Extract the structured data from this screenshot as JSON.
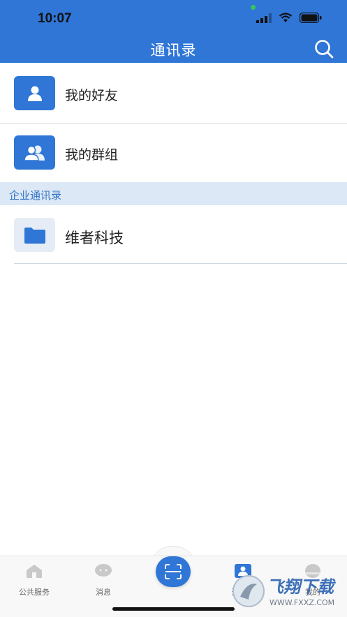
{
  "status": {
    "time": "10:07"
  },
  "nav": {
    "title": "通讯录",
    "search_icon": "search-icon"
  },
  "rows": {
    "friends": {
      "label": "我的好友",
      "icon": "person-icon"
    },
    "groups": {
      "label": "我的群组",
      "icon": "group-icon"
    }
  },
  "section": {
    "title": "企业通讯录"
  },
  "org": {
    "label": "维者科技",
    "icon": "folder-icon"
  },
  "tabs": [
    {
      "label": "公共服务",
      "icon": "home-icon"
    },
    {
      "label": "消息",
      "icon": "chat-icon"
    },
    {
      "label": "",
      "icon": "scan-icon"
    },
    {
      "label": "通讯录",
      "icon": "contacts-icon"
    },
    {
      "label": "我的",
      "icon": "profile-icon"
    }
  ],
  "watermark": {
    "text": "飞翔下载",
    "url_text": "WWW.FXXZ.COM"
  },
  "colors": {
    "accent": "#2f76d6",
    "section_bg": "#dce8f5",
    "section_text": "#3173c9"
  }
}
